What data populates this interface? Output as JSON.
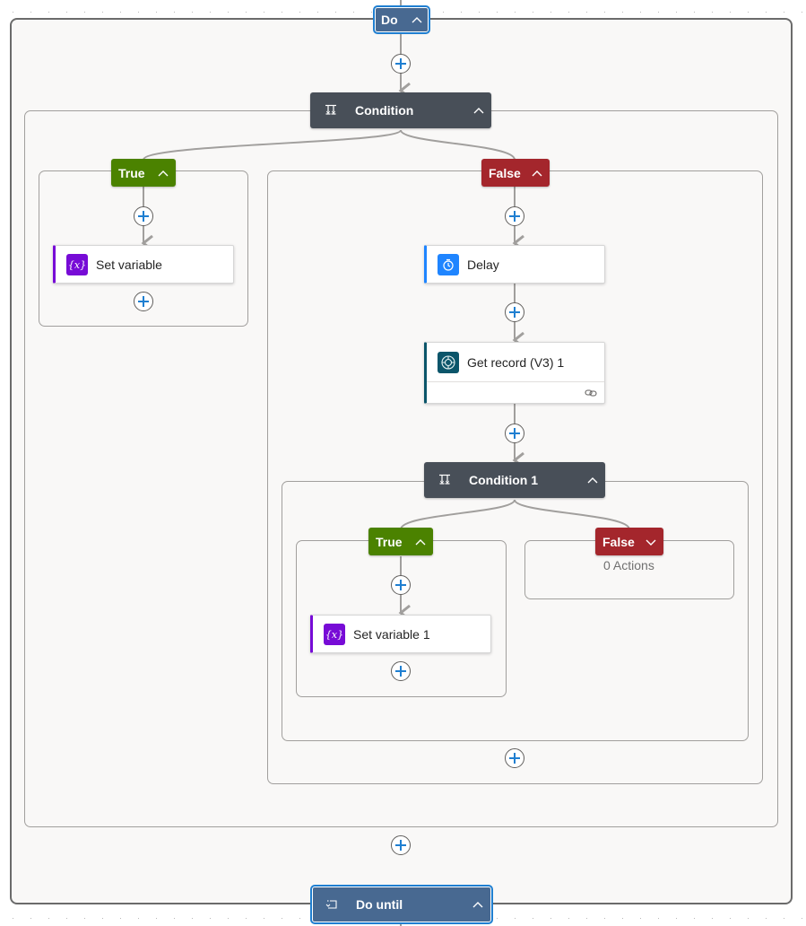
{
  "canvas": {
    "colors": {
      "loop_header": "#486991",
      "condition_header": "#484f58",
      "true_branch": "#4b8200",
      "false_branch": "#a4262c",
      "variable_icon": "#770bd6",
      "delay_icon": "#1f85ff",
      "dataverse_icon": "#0b556a",
      "add_button_accent": "#1f7fd1"
    }
  },
  "do_scope": {
    "label": "Do",
    "chevron": "chevron-up",
    "add_step_label": "Insert a new step"
  },
  "condition": {
    "label": "Condition",
    "icon": "condition-icon",
    "chevron": "chevron-up",
    "true_branch": {
      "label": "True",
      "chevron": "chevron-up",
      "actions": [
        {
          "label": "Set variable",
          "icon": "variable-icon"
        }
      ]
    },
    "false_branch": {
      "label": "False",
      "chevron": "chevron-up",
      "actions": [
        {
          "label": "Delay",
          "icon": "timer-icon"
        },
        {
          "label": "Get record (V3) 1",
          "icon": "dataverse-icon",
          "footer_icon": "link-icon"
        }
      ],
      "nested_condition": {
        "label": "Condition 1",
        "icon": "condition-icon",
        "chevron": "chevron-up",
        "true_branch": {
          "label": "True",
          "chevron": "chevron-up",
          "actions": [
            {
              "label": "Set variable 1",
              "icon": "variable-icon"
            }
          ]
        },
        "false_branch": {
          "label": "False",
          "chevron": "chevron-down",
          "empty_text": "0 Actions"
        }
      }
    }
  },
  "do_until": {
    "label": "Do until",
    "icon": "loop-icon",
    "chevron": "chevron-up"
  }
}
